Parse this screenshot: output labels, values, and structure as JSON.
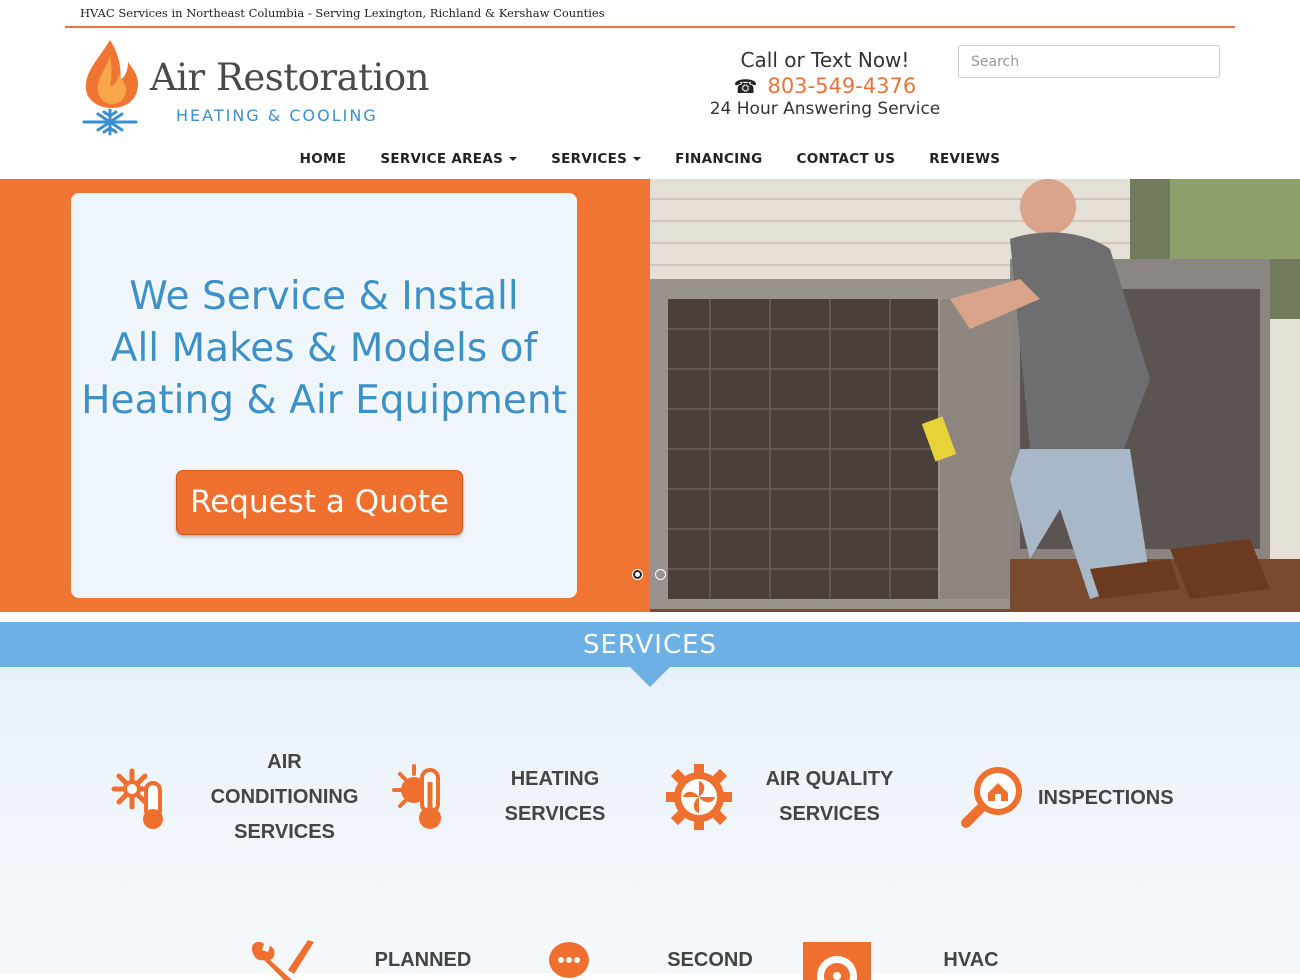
{
  "topbar": {
    "text": "HVAC Services in Northeast Columbia - Serving Lexington, Richland & Kershaw Counties"
  },
  "logo": {
    "brand": "Air Restoration",
    "tagline": "HEATING & COOLING"
  },
  "contact": {
    "call_label": "Call or Text Now!",
    "phone": "803-549-4376",
    "answering": "24 Hour Answering Service"
  },
  "search": {
    "placeholder": "Search"
  },
  "nav": {
    "items": [
      {
        "label": "HOME",
        "dropdown": false
      },
      {
        "label": "SERVICE AREAS",
        "dropdown": true
      },
      {
        "label": "SERVICES",
        "dropdown": true
      },
      {
        "label": "FINANCING",
        "dropdown": false
      },
      {
        "label": "CONTACT US",
        "dropdown": false
      },
      {
        "label": "REVIEWS",
        "dropdown": false
      }
    ]
  },
  "hero": {
    "headline_1": "We Service & Install",
    "headline_2": "All Makes & Models of",
    "headline_3": "Heating & Air Equipment",
    "cta": "Request a Quote",
    "slide_count": 2,
    "active_slide": 1
  },
  "services": {
    "title": "SERVICES",
    "items": [
      {
        "l1": "AIR",
        "l2": "CONDITIONING",
        "l3": "SERVICES",
        "icon": "snowflake-thermometer-icon"
      },
      {
        "l1": "HEATING",
        "l2": "SERVICES",
        "icon": "sun-thermometer-icon"
      },
      {
        "l1": "AIR QUALITY",
        "l2": "SERVICES",
        "icon": "fan-gear-icon"
      },
      {
        "l1": "INSPECTIONS",
        "icon": "house-magnifier-icon"
      },
      {
        "l1": "PLANNED",
        "icon": "wrench-screwdriver-icon"
      },
      {
        "l1": "SECOND",
        "icon": "chat-bubble-icon"
      },
      {
        "l1": "HVAC",
        "icon": "fan-box-icon"
      }
    ]
  },
  "colors": {
    "accent": "#f07533",
    "blue": "#3d91c9",
    "band": "#6cb0e4"
  }
}
